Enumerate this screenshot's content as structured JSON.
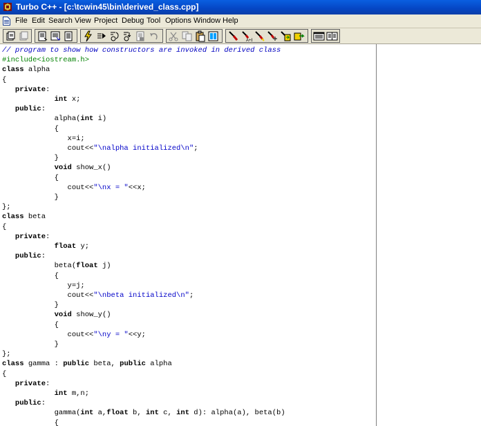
{
  "window": {
    "title": "Turbo C++ - [c:\\tcwin45\\bin\\derived_class.cpp]",
    "app_icon": "turbo-cpp-app-icon"
  },
  "menubar": {
    "doc_icon": "document-icon",
    "items": [
      "File",
      "Edit",
      "Search",
      "View",
      "Project",
      "Debug",
      "Tool",
      "Options",
      "Window",
      "Help"
    ]
  },
  "toolbar": {
    "buttons": [
      {
        "name": "open-project-icon"
      },
      {
        "name": "close-project-icon"
      },
      {
        "name": "open-file-icon"
      },
      {
        "name": "save-file-icon"
      },
      {
        "name": "new-file-icon"
      },
      {
        "name": "make-icon"
      },
      {
        "name": "run-icon"
      },
      {
        "name": "step-over-icon"
      },
      {
        "name": "trace-into-icon"
      },
      {
        "name": "toggle-breakpoint-icon"
      },
      {
        "name": "undo-icon"
      },
      {
        "name": "cut-icon"
      },
      {
        "name": "copy-icon"
      },
      {
        "name": "paste-icon"
      },
      {
        "name": "search-icon"
      },
      {
        "name": "replace-icon"
      },
      {
        "name": "search-again-icon"
      },
      {
        "name": "goto-icon"
      },
      {
        "name": "previous-message-icon"
      },
      {
        "name": "next-message-icon"
      },
      {
        "name": "window-tile-icon"
      },
      {
        "name": "window-cascade-icon"
      }
    ]
  },
  "code": {
    "lines": [
      [
        {
          "t": "// program to show how constructors are invoked in derived class",
          "c": "cmt"
        }
      ],
      [
        {
          "t": "#include<iostream.h>",
          "c": "pp"
        }
      ],
      [
        {
          "t": "class",
          "c": "kw"
        },
        {
          "t": " alpha",
          "c": ""
        }
      ],
      [
        {
          "t": "{",
          "c": ""
        }
      ],
      [
        {
          "t": "   ",
          "c": ""
        },
        {
          "t": "private",
          "c": "kw"
        },
        {
          "t": ":",
          "c": ""
        }
      ],
      [
        {
          "t": "            ",
          "c": ""
        },
        {
          "t": "int",
          "c": "kw"
        },
        {
          "t": " x;",
          "c": ""
        }
      ],
      [
        {
          "t": "   ",
          "c": ""
        },
        {
          "t": "public",
          "c": "kw"
        },
        {
          "t": ":",
          "c": ""
        }
      ],
      [
        {
          "t": "            alpha(",
          "c": ""
        },
        {
          "t": "int",
          "c": "kw"
        },
        {
          "t": " i)",
          "c": ""
        }
      ],
      [
        {
          "t": "            {",
          "c": ""
        }
      ],
      [
        {
          "t": "               x=i;",
          "c": ""
        }
      ],
      [
        {
          "t": "               cout<<",
          "c": ""
        },
        {
          "t": "\"\\nalpha initialized\\n\"",
          "c": "str"
        },
        {
          "t": ";",
          "c": ""
        }
      ],
      [
        {
          "t": "            }",
          "c": ""
        }
      ],
      [
        {
          "t": "            ",
          "c": ""
        },
        {
          "t": "void",
          "c": "kw"
        },
        {
          "t": " show_x()",
          "c": ""
        }
      ],
      [
        {
          "t": "            {",
          "c": ""
        }
      ],
      [
        {
          "t": "               cout<<",
          "c": ""
        },
        {
          "t": "\"\\nx = \"",
          "c": "str"
        },
        {
          "t": "<<x;",
          "c": ""
        }
      ],
      [
        {
          "t": "            }",
          "c": ""
        }
      ],
      [
        {
          "t": "};",
          "c": ""
        }
      ],
      [
        {
          "t": "class",
          "c": "kw"
        },
        {
          "t": " beta",
          "c": ""
        }
      ],
      [
        {
          "t": "{",
          "c": ""
        }
      ],
      [
        {
          "t": "   ",
          "c": ""
        },
        {
          "t": "private",
          "c": "kw"
        },
        {
          "t": ":",
          "c": ""
        }
      ],
      [
        {
          "t": "            ",
          "c": ""
        },
        {
          "t": "float",
          "c": "kw"
        },
        {
          "t": " y;",
          "c": ""
        }
      ],
      [
        {
          "t": "   ",
          "c": ""
        },
        {
          "t": "public",
          "c": "kw"
        },
        {
          "t": ":",
          "c": ""
        }
      ],
      [
        {
          "t": "            beta(",
          "c": ""
        },
        {
          "t": "float",
          "c": "kw"
        },
        {
          "t": " j)",
          "c": ""
        }
      ],
      [
        {
          "t": "            {",
          "c": ""
        }
      ],
      [
        {
          "t": "               y=j;",
          "c": ""
        }
      ],
      [
        {
          "t": "               cout<<",
          "c": ""
        },
        {
          "t": "\"\\nbeta initialized\\n\"",
          "c": "str"
        },
        {
          "t": ";",
          "c": ""
        }
      ],
      [
        {
          "t": "            }",
          "c": ""
        }
      ],
      [
        {
          "t": "            ",
          "c": ""
        },
        {
          "t": "void",
          "c": "kw"
        },
        {
          "t": " show_y()",
          "c": ""
        }
      ],
      [
        {
          "t": "            {",
          "c": ""
        }
      ],
      [
        {
          "t": "               cout<<",
          "c": ""
        },
        {
          "t": "\"\\ny = \"",
          "c": "str"
        },
        {
          "t": "<<y;",
          "c": ""
        }
      ],
      [
        {
          "t": "            }",
          "c": ""
        }
      ],
      [
        {
          "t": "};",
          "c": ""
        }
      ],
      [
        {
          "t": "class",
          "c": "kw"
        },
        {
          "t": " gamma : ",
          "c": ""
        },
        {
          "t": "public",
          "c": "kw"
        },
        {
          "t": " beta, ",
          "c": ""
        },
        {
          "t": "public",
          "c": "kw"
        },
        {
          "t": " alpha",
          "c": ""
        }
      ],
      [
        {
          "t": "{",
          "c": ""
        }
      ],
      [
        {
          "t": "   ",
          "c": ""
        },
        {
          "t": "private",
          "c": "kw"
        },
        {
          "t": ":",
          "c": ""
        }
      ],
      [
        {
          "t": "            ",
          "c": ""
        },
        {
          "t": "int",
          "c": "kw"
        },
        {
          "t": " m,n;",
          "c": ""
        }
      ],
      [
        {
          "t": "   ",
          "c": ""
        },
        {
          "t": "public",
          "c": "kw"
        },
        {
          "t": ":",
          "c": ""
        }
      ],
      [
        {
          "t": "            gamma(",
          "c": ""
        },
        {
          "t": "int",
          "c": "kw"
        },
        {
          "t": " a,",
          "c": ""
        },
        {
          "t": "float",
          "c": "kw"
        },
        {
          "t": " b, ",
          "c": ""
        },
        {
          "t": "int",
          "c": "kw"
        },
        {
          "t": " c, ",
          "c": ""
        },
        {
          "t": "int",
          "c": "kw"
        },
        {
          "t": " d): alpha(a), beta(b)",
          "c": ""
        }
      ],
      [
        {
          "t": "            {",
          "c": ""
        }
      ]
    ]
  }
}
